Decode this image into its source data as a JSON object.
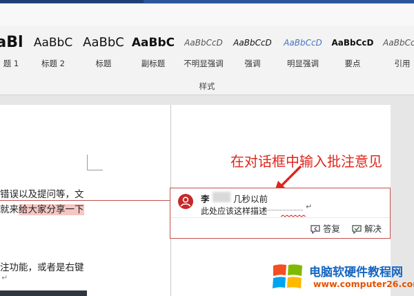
{
  "ribbon": {
    "styles": [
      {
        "preview": "aBl",
        "name": "题 1"
      },
      {
        "preview": "AaBbC",
        "name": "标题 2"
      },
      {
        "preview": "AaBbC",
        "name": "标题"
      },
      {
        "preview": "AaBbC",
        "name": "副标题"
      },
      {
        "preview": "AaBbCcD",
        "name": "不明显强调"
      },
      {
        "preview": "AaBbCcD",
        "name": "强调"
      },
      {
        "preview": "AaBbCcD",
        "name": "明显强调"
      },
      {
        "preview": "AaBbCcD",
        "name": "要点"
      },
      {
        "preview": "AaBbCcD",
        "name": "引用"
      }
    ],
    "group_label": "样式"
  },
  "document": {
    "line1": "错误以及提问等，文",
    "line2_plain": "就来",
    "line2_highlight": "给大家分享一下",
    "line3": "注功能，或者是右键",
    "pilcrow": "↵"
  },
  "comment": {
    "author": "李",
    "time": "几秒以前",
    "text": "此处应该这样描述",
    "reply_label": "答复",
    "resolve_label": "解决"
  },
  "annotation": "在对话框中输入批注意见",
  "watermark": {
    "title": "电脑软硬件教程网",
    "url": "www.computer26.com"
  },
  "colors": {
    "title_bar": "#2b579a",
    "comment_border": "#c0504d",
    "avatar": "#c62828",
    "annotation_red": "#e0251b",
    "highlight": "#f4c7c3"
  }
}
